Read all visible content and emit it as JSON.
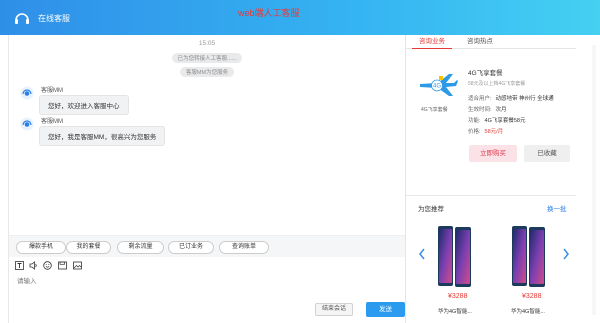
{
  "header": {
    "app_title": "在线客服",
    "demo_title": "web端人工客服"
  },
  "chat": {
    "time": "15:05",
    "system_messages": [
      "已为您转接人工客服......",
      "客服MM为您服务"
    ],
    "messages": [
      {
        "sender": "客服MM",
        "text": "您好，欢迎进入客服中心"
      },
      {
        "sender": "客服MM",
        "text": "您好，我是客服MM，很高兴为您服务"
      }
    ],
    "quick_buttons": [
      "爆款手机",
      "我的套餐",
      "剩余流量",
      "已订业务",
      "查询账单"
    ],
    "input_placeholder": "请输入",
    "end_button": "结束会话",
    "send_button": "发送"
  },
  "right": {
    "tabs": [
      "咨询业务",
      "咨询热点"
    ],
    "product": {
      "image_caption": "4G飞享套餐",
      "name": "4G飞享套餐",
      "subtitle": "58元及以上档4G飞享套餐",
      "rows": [
        {
          "label": "适合用户:",
          "value": "动感地带 神州行 全球通"
        },
        {
          "label": "生效时间:",
          "value": "次月"
        },
        {
          "label": "功能:",
          "value": "4G飞享套餐58元"
        }
      ],
      "price_label": "价格:",
      "price_value": "58元/月",
      "buy_button": "立即购买",
      "fav_button": "已收藏"
    },
    "recommend": {
      "title": "为您推荐",
      "change": "换一批",
      "items": [
        {
          "price": "¥3288",
          "name": "华为4G智能..."
        },
        {
          "price": "¥3288",
          "name": "华为4G智能..."
        }
      ]
    }
  },
  "colors": {
    "header_start": "#2f8fe8",
    "header_end": "#45d0f2",
    "accent_red": "#e53935",
    "send_blue": "#2b9bf0"
  },
  "icons": [
    "headset-logo-icon",
    "customer-avatar-icon",
    "text-format-icon",
    "voice-icon",
    "emoji-icon",
    "folder-icon",
    "image-icon",
    "plane-icon",
    "chevron-left-icon",
    "chevron-right-icon"
  ]
}
